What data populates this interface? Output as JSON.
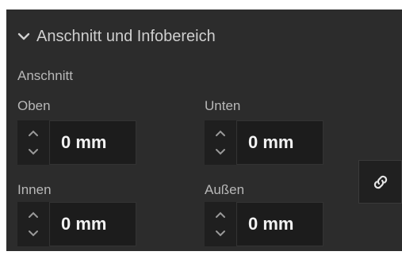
{
  "section": {
    "title": "Anschnitt und Infobereich",
    "subtitle": "Anschnitt"
  },
  "fields": {
    "oben": {
      "label": "Oben",
      "value": "0 mm"
    },
    "unten": {
      "label": "Unten",
      "value": "0 mm"
    },
    "innen": {
      "label": "Innen",
      "value": "0 mm"
    },
    "aussen": {
      "label": "Außen",
      "value": "0 mm"
    }
  },
  "icons": {
    "collapse": "chevron-down-icon",
    "link": "link-chain-icon",
    "step_up": "chevron-up-icon",
    "step_down": "chevron-down-icon"
  },
  "colors": {
    "panel_bg": "#2c2c2c",
    "field_bg": "#1c1c1c",
    "text": "#d0d0d0",
    "value_text": "#f2f2f2"
  }
}
